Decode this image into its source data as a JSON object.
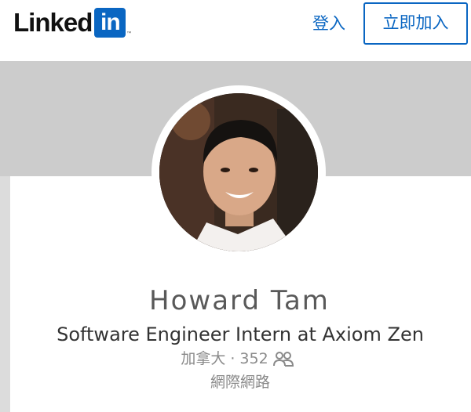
{
  "header": {
    "logo_word": "Linked",
    "logo_box": "in",
    "logo_tm": "™",
    "signin_label": "登入",
    "join_label": "立即加入"
  },
  "profile": {
    "name": "Howard Tam",
    "headline": "Software Engineer Intern at Axiom Zen",
    "location": "加拿大",
    "separator": "·",
    "connections": "352",
    "industry": "網際網路"
  },
  "colors": {
    "brand": "#0a66c2",
    "banner": "#dcdcdc"
  },
  "icons": {
    "connections": "people-icon"
  }
}
